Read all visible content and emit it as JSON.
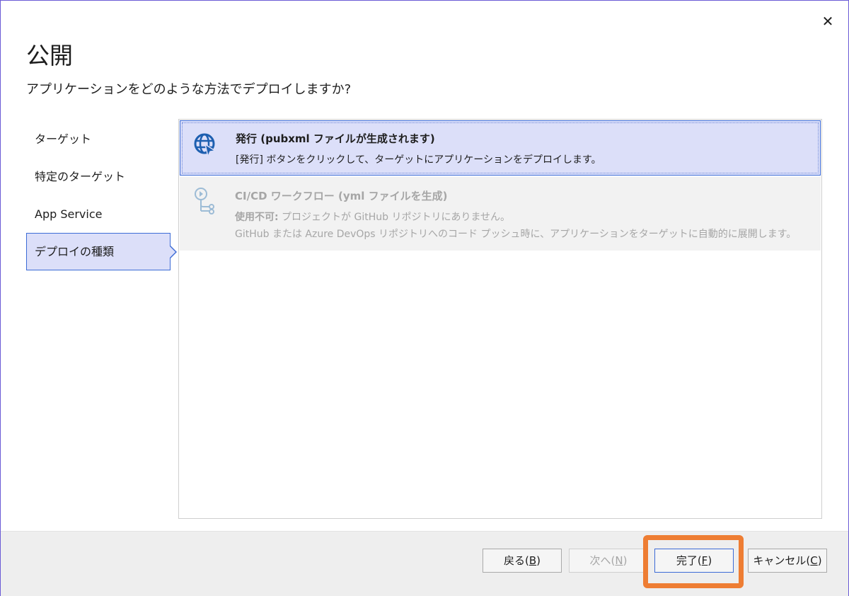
{
  "window": {
    "title": "公開",
    "close_glyph": "✕"
  },
  "subtitle": "アプリケーションをどのような方法でデプロイしますか?",
  "nav": {
    "items": [
      {
        "label": "ターゲット"
      },
      {
        "label": "特定のターゲット"
      },
      {
        "label": "App Service"
      },
      {
        "label": "デプロイの種類",
        "active": true
      }
    ]
  },
  "options": [
    {
      "title": "発行 (pubxml ファイルが生成されます)",
      "description": "[発行] ボタンをクリックして、ターゲットにアプリケーションをデプロイします。",
      "icon": "globe-cursor-icon",
      "selected": true
    },
    {
      "title": "CI/CD ワークフロー (yml ファイルを生成)",
      "description_label": "使用不可:",
      "description_line1": " プロジェクトが GitHub リポジトリにありません。",
      "description_line2": "GitHub または Azure DevOps リポジトリへのコード プッシュ時に、アプリケーションをターゲットに自動的に展開します。",
      "icon": "workflow-icon",
      "disabled": true
    }
  ],
  "footer": {
    "back": {
      "text": "戻る(",
      "key": "B",
      "close": ")"
    },
    "next": {
      "text": "次へ(",
      "key": "N",
      "close": ")"
    },
    "finish": {
      "text": "完了(",
      "key": "F",
      "close": ")"
    },
    "cancel": {
      "text": "キャンセル(",
      "key": "C",
      "close": ")"
    }
  },
  "colors": {
    "accent": "#3c6bd6",
    "selection_bg": "#dcdff9",
    "highlight": "#ee7d33"
  }
}
